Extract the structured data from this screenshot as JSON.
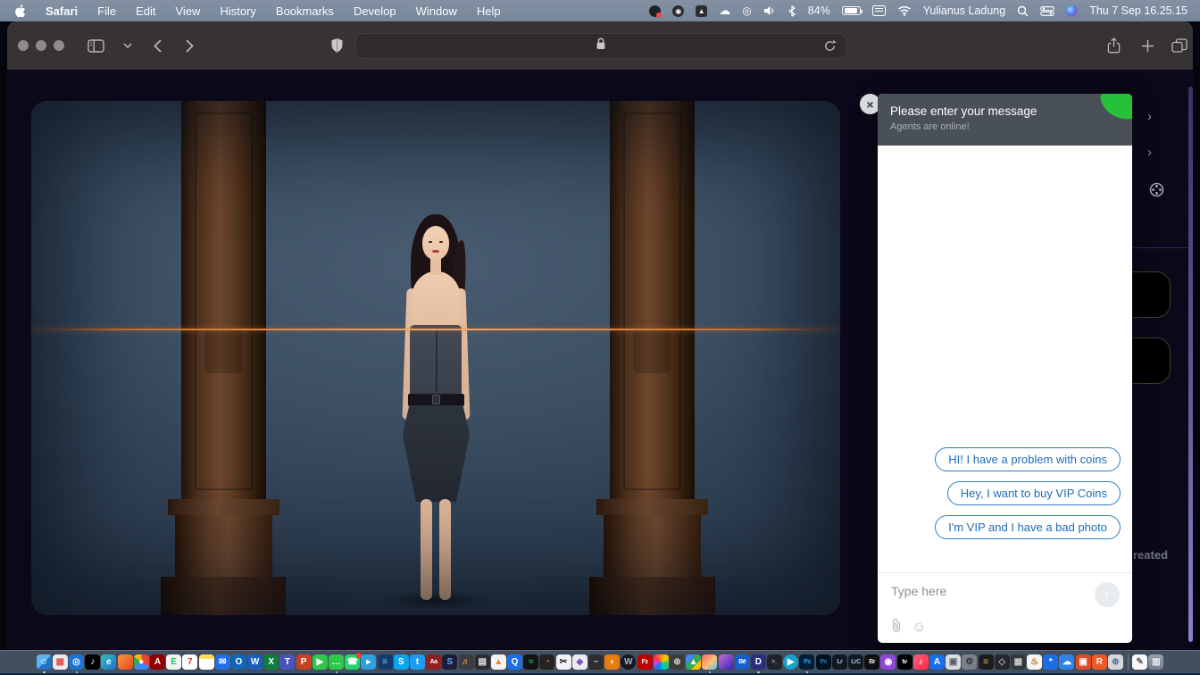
{
  "menubar": {
    "menus": [
      "Safari",
      "File",
      "Edit",
      "View",
      "History",
      "Bookmarks",
      "Develop",
      "Window",
      "Help"
    ],
    "user_name": "Yulianus Ladung",
    "clock": "Thu 7 Sep 16.25.15",
    "battery_label": "84%",
    "battery_level": 84,
    "status_icons": [
      "screen-record-icon",
      "round-app-icon",
      "triangle-app-icon",
      "cloud-sync-icon",
      "airplay-icon",
      "volume-icon",
      "bluetooth-icon",
      "battery-indicator",
      "input-source-icon",
      "wifi-icon",
      "spotlight-search-icon",
      "control-center-icon",
      "siri-icon"
    ]
  },
  "toolbar": {
    "icons": [
      "sidebar-icon",
      "tab-group-chevron-icon",
      "back-icon",
      "forward-icon",
      "privacy-shield-icon",
      "lock-icon",
      "reload-icon",
      "share-icon",
      "new-tab-icon",
      "tab-overview-icon"
    ]
  },
  "chat": {
    "title": "Please enter your message",
    "subtitle": "Agents are online!",
    "replies": [
      "HI! I have a problem with coins",
      "Hey, I want to buy VIP Coins",
      "I'm VIP and I have a bad photo"
    ],
    "input_placeholder": "Type here",
    "accent_green": "#25c13a",
    "reply_blue": "#1e6cb8"
  },
  "right_rail": {
    "partial_text": "reated",
    "scrollbar_color": "#907fc8"
  },
  "hero": {
    "scanline_color": "#e8863a"
  },
  "dock": {
    "icons": [
      {
        "name": "finder",
        "bg": "linear-gradient(135deg,#5fb2f2 50%,#1f72c4 50%)",
        "glyph": "☺",
        "fg": "#fff",
        "run": true
      },
      {
        "name": "launchpad",
        "bg": "#e8eaed",
        "glyph": "▦",
        "fg": "#e05252"
      },
      {
        "name": "safari",
        "bg": "#1b74d3",
        "glyph": "◎",
        "fg": "#fff",
        "run": true
      },
      {
        "name": "tiktok",
        "bg": "#000000",
        "glyph": "♪",
        "fg": "#fff"
      },
      {
        "name": "edge",
        "bg": "linear-gradient(135deg,#35c3b4,#1b6fd0)",
        "glyph": "e",
        "fg": "#fff"
      },
      {
        "name": "firefox",
        "bg": "linear-gradient(135deg,#ff9640,#e0461f)",
        "glyph": "",
        "fg": "#fff"
      },
      {
        "name": "chrome",
        "cls": "chrome",
        "glyph": "●",
        "fg": "#ffffff"
      },
      {
        "name": "acrobat",
        "bg": "#8e0000",
        "glyph": "A",
        "fg": "#fff"
      },
      {
        "name": "evernote",
        "bg": "#f2f4f5",
        "glyph": "E",
        "fg": "#2dbe60"
      },
      {
        "name": "calendar",
        "bg": "#ffffff",
        "glyph": "7",
        "fg": "#e03b30"
      },
      {
        "name": "notes",
        "bg": "linear-gradient(#ffdf5e 30%,#fff 30%)",
        "glyph": "",
        "fg": "#444"
      },
      {
        "name": "mail",
        "bg": "#1f70e8",
        "glyph": "✉",
        "fg": "#fff"
      },
      {
        "name": "outlook",
        "bg": "#1066b8",
        "glyph": "O",
        "fg": "#fff"
      },
      {
        "name": "word",
        "bg": "#1b5ebe",
        "glyph": "W",
        "fg": "#fff"
      },
      {
        "name": "excel",
        "bg": "#0f7c40",
        "glyph": "X",
        "fg": "#fff"
      },
      {
        "name": "teams",
        "bg": "#4a53bd",
        "glyph": "T",
        "fg": "#fff"
      },
      {
        "name": "powerpoint",
        "bg": "#c8421f",
        "glyph": "P",
        "fg": "#fff"
      },
      {
        "name": "facetime",
        "bg": "#30c84b",
        "glyph": "▶",
        "fg": "#fff"
      },
      {
        "name": "messages",
        "bg": "#30c84b",
        "glyph": "…",
        "fg": "#fff",
        "run": true
      },
      {
        "name": "whatsapp",
        "bg": "#28d366",
        "glyph": "☎",
        "fg": "#fff",
        "badge": true
      },
      {
        "name": "telegram",
        "bg": "#2ba0dc",
        "glyph": "▸",
        "fg": "#fff"
      },
      {
        "name": "blue-doc-app",
        "bg": "#143a6e",
        "glyph": "≡",
        "fg": "#7fb4ff"
      },
      {
        "name": "skype",
        "bg": "#0aa4ef",
        "glyph": "S",
        "fg": "#fff"
      },
      {
        "name": "twitter",
        "bg": "#1d9bf0",
        "glyph": "t",
        "fg": "#fff"
      },
      {
        "name": "font-book",
        "bg": "#8e2020",
        "glyph": "Aa",
        "fg": "#fff"
      },
      {
        "name": "shazam",
        "bg": "#1d1d3a",
        "glyph": "S",
        "fg": "#58aaff"
      },
      {
        "name": "garageband",
        "bg": "#3c3c3e",
        "glyph": "♬",
        "fg": "#ff9f3a"
      },
      {
        "name": "midi-keyboard",
        "bg": "#2c2c2e",
        "glyph": "▤",
        "fg": "#e8e8e8"
      },
      {
        "name": "vlc",
        "bg": "#f4f4f4",
        "glyph": "▲",
        "fg": "#ff7d00"
      },
      {
        "name": "quicktime",
        "bg": "#1a6fe8",
        "glyph": "Q",
        "fg": "#fff"
      },
      {
        "name": "spotify",
        "bg": "#141414",
        "glyph": "≈",
        "fg": "#1db954"
      },
      {
        "name": "gauge-app",
        "bg": "#262222",
        "glyph": "◔",
        "fg": "#ff5a1f"
      },
      {
        "name": "capcut",
        "bg": "#f2f2f2",
        "glyph": "✂",
        "fg": "#111"
      },
      {
        "name": "final-cut",
        "bg": "#ececec",
        "glyph": "◆",
        "fg": "#8a4fd8"
      },
      {
        "name": "audio-app",
        "bg": "#2e2e30",
        "glyph": "~",
        "fg": "#bbb"
      },
      {
        "name": "blender",
        "bg": "#e87d0d",
        "glyph": "◗",
        "fg": "#fff"
      },
      {
        "name": "wordpress",
        "bg": "#15181d",
        "glyph": "W",
        "fg": "#9fb6c8",
        "round": true
      },
      {
        "name": "filezilla",
        "bg": "#bf0000",
        "glyph": "Fz",
        "fg": "#fff"
      },
      {
        "name": "photos",
        "cls": "photos",
        "glyph": "",
        "fg": "#fff"
      },
      {
        "name": "screenshot",
        "bg": "#3c3c3e",
        "glyph": "⊕",
        "fg": "#ccc"
      },
      {
        "name": "google-drive",
        "cls": "drive",
        "glyph": "▲",
        "fg": "#fff"
      },
      {
        "name": "gradient-app-1",
        "cls": "grad1",
        "glyph": "",
        "fg": "#fff",
        "run": true
      },
      {
        "name": "gradient-app-2",
        "cls": "grad2",
        "glyph": "",
        "fg": "#fff"
      },
      {
        "name": "behance",
        "bg": "#1460c8",
        "glyph": "Bē",
        "fg": "#fff"
      },
      {
        "name": "discord",
        "bg": "#2b2e7e",
        "glyph": "D",
        "fg": "#fff",
        "run": true
      },
      {
        "name": "terminal",
        "bg": "#20222b",
        "glyph": ">_",
        "fg": "#9fb0bb"
      },
      {
        "name": "video-player",
        "bg": "#17a3c9",
        "glyph": "▶",
        "fg": "#fff",
        "round": true
      },
      {
        "name": "photoshop",
        "bg": "#001e36",
        "glyph": "Ps",
        "fg": "#31a8ff",
        "run": true
      },
      {
        "name": "photoshop-beta",
        "bg": "#00121f",
        "glyph": "Ps",
        "fg": "#2b7eb8"
      },
      {
        "name": "lightroom",
        "bg": "#101820",
        "glyph": "Lr",
        "fg": "#9fc0dc"
      },
      {
        "name": "lightroom-classic",
        "bg": "#101820",
        "glyph": "LrC",
        "fg": "#9fc0dc"
      },
      {
        "name": "bridge",
        "bg": "#0f0f0f",
        "glyph": "Br",
        "fg": "#eee"
      },
      {
        "name": "podcasts",
        "bg": "#9047d8",
        "glyph": "◉",
        "fg": "#fff"
      },
      {
        "name": "apple-tv",
        "bg": "#000000",
        "glyph": "tv",
        "fg": "#fff"
      },
      {
        "name": "music",
        "cls": "music",
        "glyph": "♪",
        "fg": "#fff"
      },
      {
        "name": "app-store",
        "bg": "#1a6fe8",
        "glyph": "A",
        "fg": "#fff"
      },
      {
        "name": "preview",
        "bg": "#d9dbde",
        "glyph": "▣",
        "fg": "#55606e"
      },
      {
        "name": "settings",
        "bg": "#7a8088",
        "glyph": "⚙",
        "fg": "#2e3238"
      },
      {
        "name": "wallet",
        "bg": "#1d1d20",
        "glyph": "≡",
        "fg": "#e2b44e"
      },
      {
        "name": "automator",
        "bg": "#26272c",
        "glyph": "◇",
        "fg": "#aab"
      },
      {
        "name": "calculator",
        "bg": "#34383d",
        "glyph": "▦",
        "fg": "#ccc"
      },
      {
        "name": "homebrew",
        "bg": "#f5f5f5",
        "glyph": "♨",
        "fg": "#c46a1a"
      },
      {
        "name": "bluetooth-exchange",
        "bg": "#1a6fe8",
        "glyph": "*",
        "fg": "#fff"
      },
      {
        "name": "weather",
        "bg": "#2f82e8",
        "glyph": "☁",
        "fg": "#fff"
      },
      {
        "name": "red-box-app",
        "bg": "#e04a2a",
        "glyph": "▣",
        "fg": "#fff"
      },
      {
        "name": "orange-r-app",
        "bg": "#f05a22",
        "glyph": "R",
        "fg": "#fff"
      },
      {
        "name": "network-globe",
        "bg": "#d3d7db",
        "glyph": "⊕",
        "fg": "#4a6fa0"
      },
      {
        "name": "separator",
        "sep": true
      },
      {
        "name": "textedit",
        "bg": "#f8f8f8",
        "glyph": "✎",
        "fg": "#666"
      },
      {
        "name": "trash",
        "cls": "trash",
        "glyph": "▥",
        "fg": "#eef1f5"
      }
    ]
  }
}
